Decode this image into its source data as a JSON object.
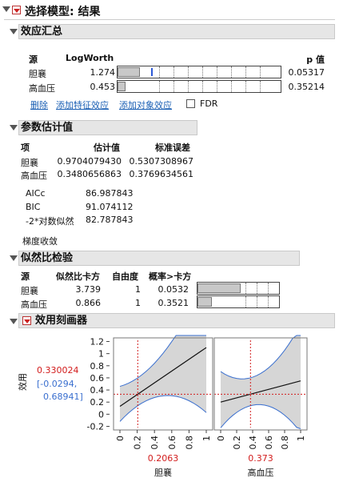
{
  "title": "选择模型: 结果",
  "effect_summary": {
    "header": "效应汇总",
    "columns": [
      "源",
      "LogWorth",
      "p 值"
    ],
    "rows": [
      {
        "source": "胆襄",
        "logworth": "1.274",
        "p": "0.05317",
        "bar_fraction": 0.28
      },
      {
        "source": "高血压",
        "logworth": "0.453",
        "p": "0.35214",
        "bar_fraction": 0.1
      }
    ],
    "links": [
      "删除",
      "添加特征效应",
      "添加对象效应"
    ],
    "fdr_label": "FDR"
  },
  "param_estimates": {
    "header": "参数估计值",
    "columns": [
      "项",
      "估计值",
      "标准误差"
    ],
    "rows": [
      {
        "term": "胆襄",
        "estimate": "0.9704079430",
        "stderr": "0.5307308967"
      },
      {
        "term": "高血压",
        "estimate": "0.3480656863",
        "stderr": "0.3769634561"
      }
    ],
    "stats": [
      {
        "label": "AICc",
        "value": "86.987843"
      },
      {
        "label": "BIC",
        "value": "91.074112"
      },
      {
        "label": "-2*对数似然",
        "value": "82.787843"
      }
    ],
    "note": "梯度收敛"
  },
  "lr_test": {
    "header": "似然比检验",
    "columns": [
      "源",
      "似然比卡方",
      "自由度",
      "概率>卡方"
    ],
    "rows": [
      {
        "source": "胆襄",
        "chisq": "3.739",
        "df": "1",
        "prob": "0.0532",
        "bar_fraction": 0.67
      },
      {
        "source": "高血压",
        "chisq": "0.866",
        "df": "1",
        "prob": "0.3521",
        "bar_fraction": 0.22
      }
    ]
  },
  "profiler": {
    "header": "效用刻画器",
    "ylabel": "效用",
    "current_value": "0.330024",
    "ci_text_1": "[-0.0294,",
    "ci_text_2": "0.68941]",
    "y_ticks": [
      "1.2",
      "1",
      "0.8",
      "0.6",
      "0.4",
      "0.2",
      "0",
      "-0.2"
    ],
    "x_ticks": [
      "0",
      "0.2",
      "0.4",
      "0.6",
      "0.8",
      "1"
    ],
    "factors": [
      {
        "name": "胆襄",
        "current": "0.2063",
        "x": 0.2063,
        "y0": 0.13,
        "y1": 1.1,
        "lo0": -0.18,
        "lo1": -0.03,
        "mid_lo": 0.0,
        "hi0": 0.4,
        "hi1": 1.2
      },
      {
        "name": "高血压",
        "current": "0.373",
        "x": 0.373,
        "y0": 0.2,
        "y1": 0.55,
        "lo0": -0.13,
        "lo1": -0.2,
        "mid_lo": 0.0,
        "hi0": 0.42,
        "hi1": 1.2
      }
    ],
    "colors": {
      "red": "#d21c1c",
      "blue": "#3a6fcf",
      "band": "#d6d6d6"
    }
  }
}
